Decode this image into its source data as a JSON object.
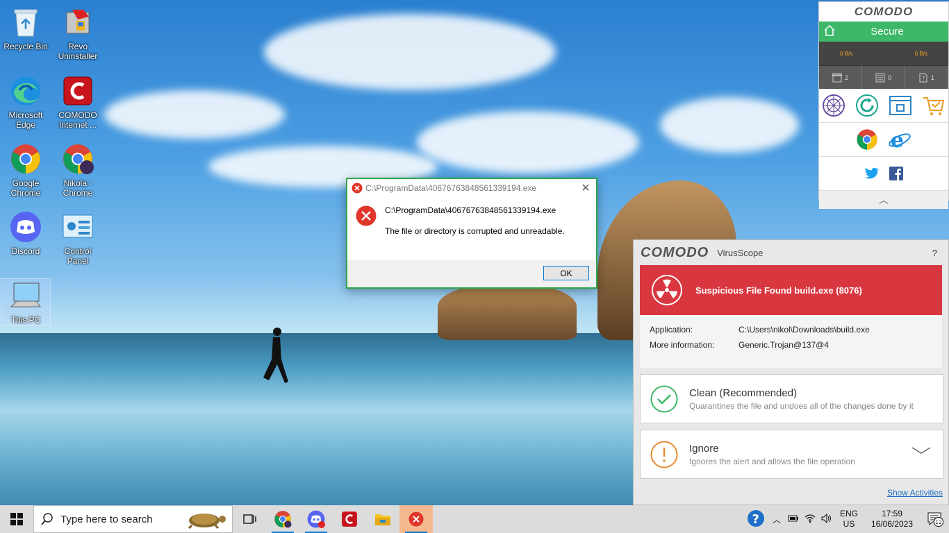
{
  "desktop": {
    "icons": [
      {
        "label": "Recycle Bin"
      },
      {
        "label": "Revo Uninstaller"
      },
      {
        "label": "Microsoft Edge"
      },
      {
        "label": "COMODO Internet ..."
      },
      {
        "label": "Google Chrome"
      },
      {
        "label": "Nikola - Chrome"
      },
      {
        "label": "Discord"
      },
      {
        "label": "Control Panel"
      },
      {
        "label": "This PC"
      }
    ]
  },
  "error_dialog": {
    "title": "C:\\ProgramData\\40676763848561339194.exe",
    "path": "C:\\ProgramData\\40676763848561339194.exe",
    "message": "The file or directory is corrupted and unreadable.",
    "ok_label": "OK"
  },
  "comodo_widget": {
    "logo": "COMODO",
    "status": "Secure",
    "upload_speed": "0 B/s",
    "download_speed": "0 B/s",
    "counts": [
      "2",
      "0",
      "1"
    ]
  },
  "virusscope": {
    "brand": "COMODO",
    "product": "VirusScope",
    "help": "?",
    "alert_title": "Suspicious File Found build.exe (8076)",
    "application_label": "Application:",
    "application_value": "C:\\Users\\nikol\\Downloads\\build.exe",
    "more_info_label": "More information:",
    "more_info_value": "Generic.Trojan@137@4",
    "options": [
      {
        "title": "Clean (Recommended)",
        "desc": "Quarantines the file and undoes all of the changes done by it"
      },
      {
        "title": "Ignore",
        "desc": "Ignores the alert and allows the file operation"
      }
    ],
    "show_activities": "Show Activities"
  },
  "taskbar": {
    "search_placeholder": "Type here to search",
    "lang_top": "ENG",
    "lang_bottom": "US",
    "time": "17:59",
    "date": "16/06/2023",
    "notification_count": "12"
  },
  "colors": {
    "comodo_green": "#3cb868",
    "alert_red": "#d93740",
    "dialog_border": "#2ea84a",
    "clean_green": "#3cb868",
    "ignore_orange": "#e8892f"
  }
}
